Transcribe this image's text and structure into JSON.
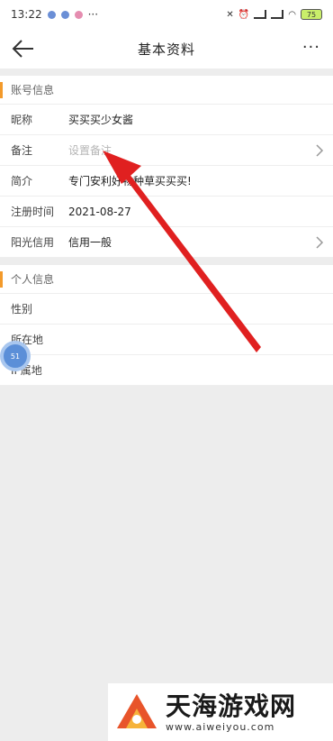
{
  "status_bar": {
    "time": "13:22",
    "dots": "···",
    "battery": "75"
  },
  "header": {
    "title": "基本资料",
    "more": "···"
  },
  "account_section": {
    "title": "账号信息",
    "rows": [
      {
        "label": "昵称",
        "value": "买买买少女酱"
      },
      {
        "label": "备注",
        "value": "设置备注",
        "placeholder": true
      },
      {
        "label": "简介",
        "value": "专门安利好物种草买买买!"
      },
      {
        "label": "注册时间",
        "value": "2021-08-27"
      },
      {
        "label": "阳光信用",
        "value": "信用一般"
      }
    ]
  },
  "personal_section": {
    "title": "个人信息",
    "rows": [
      {
        "label": "性别",
        "value": ""
      },
      {
        "label": "所在地",
        "value": ""
      },
      {
        "label": "IP属地",
        "value": ""
      }
    ]
  },
  "float_ball": {
    "label": "51"
  },
  "watermark": {
    "name": "天海游戏网",
    "url": "www.aiweiyou.com"
  },
  "colors": {
    "accent_bar": "#f39a2b",
    "arrow": "#e02020",
    "float_ball": "#5b8fd8"
  }
}
